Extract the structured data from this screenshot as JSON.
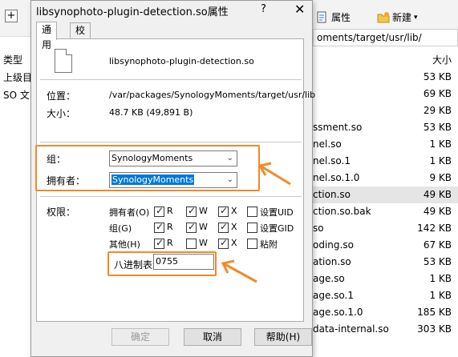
{
  "file_manager": {
    "left": {
      "column_type": "类型",
      "rows": [
        "上级目",
        "SO 文"
      ]
    },
    "toolbar": {
      "properties_label": "属性",
      "new_label": "新建",
      "new_caret": "▾"
    },
    "path": "oments/target/usr/lib/",
    "size_header": "大小",
    "rows": [
      {
        "name": "",
        "size": "53 KB"
      },
      {
        "name": "",
        "size": "69 KB"
      },
      {
        "name": "",
        "size": "29 KB"
      },
      {
        "name": "ssment.so",
        "size": "53 KB"
      },
      {
        "name": "nel.so",
        "size": "1 KB"
      },
      {
        "name": "nel.so.1",
        "size": "1 KB"
      },
      {
        "name": "nel.so.1.0",
        "size": "9 KB"
      },
      {
        "name": "ction.so",
        "size": "49 KB",
        "selected": true
      },
      {
        "name": "ction.so.bak",
        "size": "49 KB"
      },
      {
        "name": "so",
        "size": "142 KB"
      },
      {
        "name": "oding.so",
        "size": "67 KB"
      },
      {
        "name": "ation.so",
        "size": "53 KB"
      },
      {
        "name": "age.so",
        "size": "1 KB"
      },
      {
        "name": "age.so.1",
        "size": "1 KB"
      },
      {
        "name": "age.so.1.0",
        "size": "185 KB"
      },
      {
        "name": "data-internal.so",
        "size": "303 KB"
      }
    ]
  },
  "dialog": {
    "title": "libsynophoto-plugin-detection.so属性",
    "help_glyph": "?",
    "close_glyph": "✕",
    "tabs": [
      {
        "label": "通用",
        "active": true
      },
      {
        "label": "校验码",
        "active": false
      }
    ],
    "file_name": "libsynophoto-plugin-detection.so",
    "location_label": "位置：",
    "location_value": "/var/packages/SynologyMoments/target/usr/lib",
    "size_label": "大小：",
    "size_value": "48.7 KB (49,891 B)",
    "group_label": "组：",
    "group_value": "SynologyMoments",
    "owner_label": "拥有者：",
    "owner_value": "SynologyMoments",
    "permissions_label": "权限：",
    "permissions": [
      {
        "role": "拥有者(O)",
        "r": true,
        "w": true,
        "x": true,
        "special": "设置UID",
        "special_on": false
      },
      {
        "role": "组(G)",
        "r": true,
        "w": true,
        "x": true,
        "special": "设置GID",
        "special_on": false
      },
      {
        "role": "其他(H)",
        "r": true,
        "w": false,
        "x": true,
        "special": "粘附",
        "special_on": false
      }
    ],
    "perm_letters": {
      "r": "R",
      "w": "W",
      "x": "X"
    },
    "octal_label": "八进制表示",
    "octal_value": "0755",
    "buttons": {
      "ok": "确定",
      "cancel": "取消",
      "help": "帮助(H)"
    }
  },
  "accent_colors": {
    "annotation_orange": "#f08a2a",
    "selection_blue": "#0078d7"
  }
}
